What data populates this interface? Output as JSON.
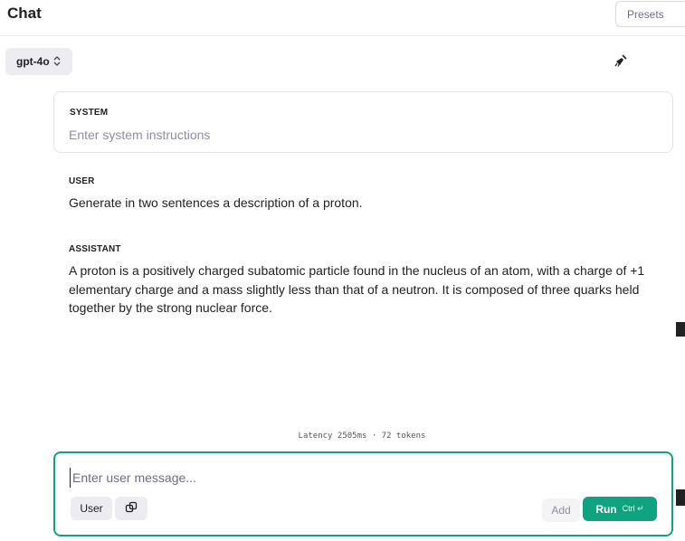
{
  "header": {
    "title": "Chat",
    "presets_label": "Presets"
  },
  "model": {
    "selected": "gpt-4o"
  },
  "system": {
    "label": "SYSTEM",
    "placeholder": "Enter system instructions",
    "value": ""
  },
  "messages": [
    {
      "role": "USER",
      "text": "Generate in two sentences a description of a proton."
    },
    {
      "role": "ASSISTANT",
      "text": "A proton is a positively charged subatomic particle found in the nucleus of an atom, with a charge of +1 elementary charge and a mass slightly less than that of a neutron. It is composed of three quarks held together by the strong nuclear force."
    }
  ],
  "stats": {
    "latency_text": "Latency 2505ms · 72 tokens"
  },
  "composer": {
    "placeholder": "Enter user message...",
    "value": "",
    "role_label": "User",
    "add_label": "Add",
    "run_label": "Run",
    "run_shortcut": "Ctrl ↵"
  },
  "colors": {
    "accent": "#10a37f",
    "button_bg": "#ececf1",
    "border": "#e5e5e5"
  },
  "icons": {
    "model_chevron": "chevron-up-down-icon",
    "clear": "broom-icon",
    "swap": "swap-icon"
  }
}
